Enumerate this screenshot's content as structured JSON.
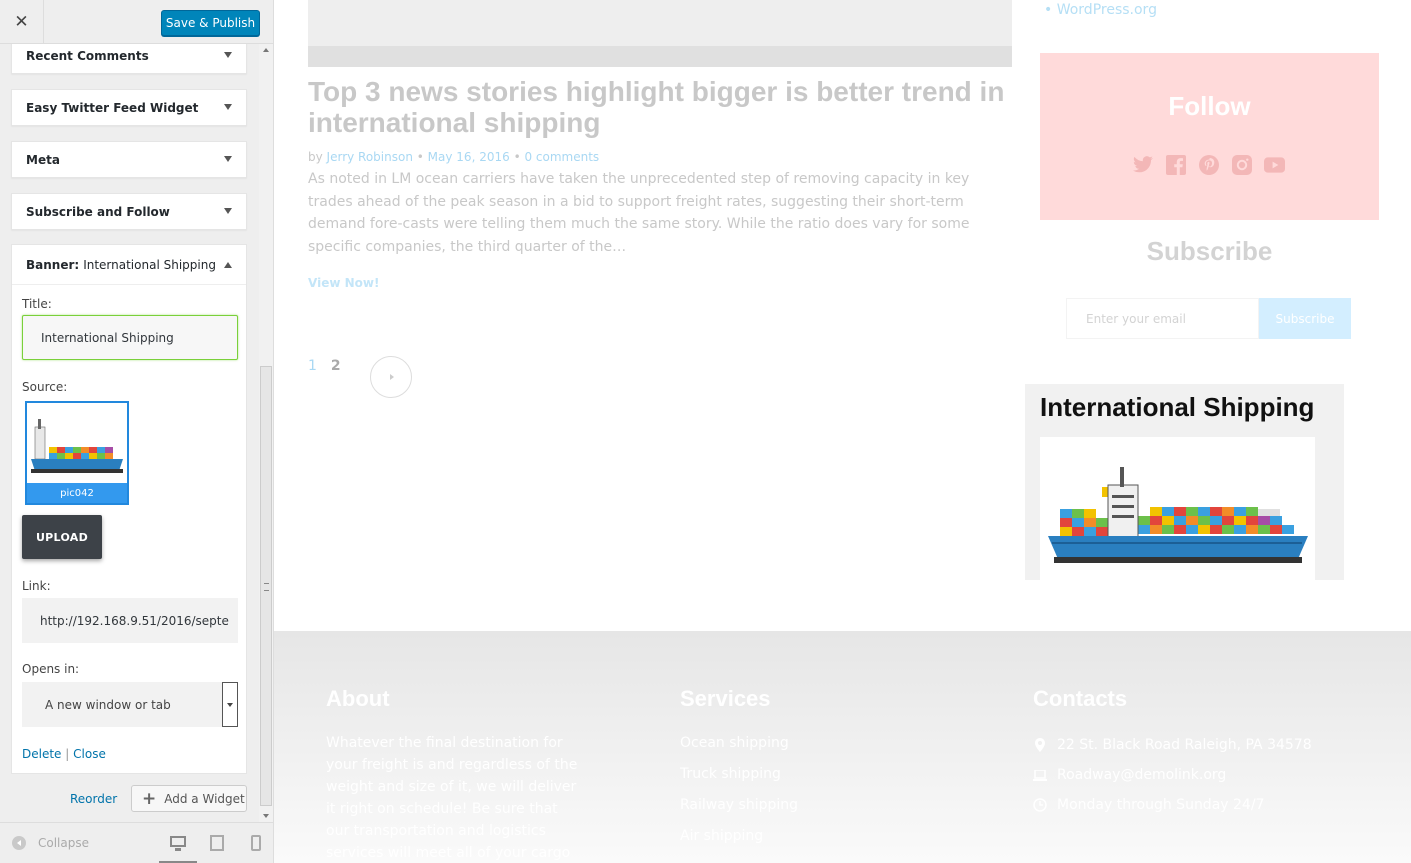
{
  "customizer": {
    "close_icon": "close-icon",
    "publish_label": "Save & Publish",
    "widgets": [
      {
        "label": "Recent Comments"
      },
      {
        "label": "Easy Twitter Feed Widget"
      },
      {
        "label": "Meta"
      },
      {
        "label": "Subscribe and Follow"
      }
    ],
    "banner_widget": {
      "head_prefix": "Banner:",
      "head_title": "International Shipping",
      "title_label": "Title:",
      "title_value": "International Shipping",
      "source_label": "Source:",
      "source_file": "pic042",
      "upload_label": "UPLOAD",
      "link_label": "Link:",
      "link_value": "http://192.168.9.51/2016/septe",
      "opens_label": "Opens in:",
      "opens_value": "A new window or tab",
      "delete_label": "Delete",
      "separator": "|",
      "close_label": "Close"
    },
    "reorder_label": "Reorder",
    "add_widget_label": "Add a Widget",
    "collapse_label": "Collapse"
  },
  "preview": {
    "post": {
      "title": "Top 3 news stories highlight bigger is better trend in international shipping",
      "by": "by",
      "author": "Jerry Robinson",
      "dot": "•",
      "date": "May 16, 2016",
      "comments": "0 comments",
      "excerpt": "As noted in LM ocean carriers have taken the unprecedented step of removing capacity in key trades ahead of the peak season in a bid to support freight rates, suggesting their short-term demand fore-casts were telling them much the same story. While the ratio does vary for some specific companies, the third quarter of the…",
      "read_more": "View Now!"
    },
    "pagination": {
      "page1": "1",
      "page2": "2"
    },
    "sidebar": {
      "wp_link": "• WordPress.org",
      "follow_title": "Follow",
      "social": [
        "twitter-icon",
        "facebook-icon",
        "pinterest-icon",
        "instagram-icon",
        "youtube-icon"
      ],
      "subscribe_title": "Subscribe",
      "email_placeholder": "Enter your email",
      "subscribe_button": "Subscribe",
      "banner_title": "International Shipping"
    },
    "footer": {
      "about_head": "About",
      "about_text": "Whatever the final destination for your freight is and regardless of the weight and size of it, we will deliver it right on schedule! Be sure that our transportation and logistics services will meet all of your cargo requirements.",
      "services_head": "Services",
      "services": [
        "Ocean shipping",
        "Truck shipping",
        "Railway shipping",
        "Air shipping"
      ],
      "contacts_head": "Contacts",
      "address": "22 St. Black Road Raleigh, PA 34578",
      "email": "Roadway@demolink.org",
      "hours": "Monday through Sunday 24/7"
    }
  },
  "colors": {
    "publish": "#0085ba",
    "link": "#0073aa",
    "follow_bg": "#ffdada",
    "upload_bg": "#3d4248"
  }
}
